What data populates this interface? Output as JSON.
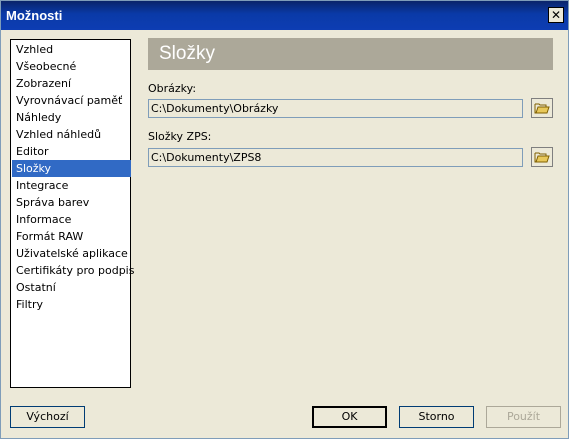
{
  "window": {
    "title": "Možnosti"
  },
  "nav": {
    "items": [
      {
        "label": "Vzhled"
      },
      {
        "label": "Všeobecné"
      },
      {
        "label": "Zobrazení"
      },
      {
        "label": "Vyrovnávací paměť"
      },
      {
        "label": "Náhledy"
      },
      {
        "label": "Vzhled náhledů"
      },
      {
        "label": "Editor"
      },
      {
        "label": "Složky",
        "selected": true
      },
      {
        "label": "Integrace"
      },
      {
        "label": "Správa barev"
      },
      {
        "label": "Informace"
      },
      {
        "label": "Formát RAW"
      },
      {
        "label": "Uživatelské aplikace"
      },
      {
        "label": "Certifikáty pro podpis"
      },
      {
        "label": "Ostatní"
      },
      {
        "label": "Filtry"
      }
    ]
  },
  "panel": {
    "title": "Složky",
    "images_label": "Obrázky:",
    "images_path": "C:\\Dokumenty\\Obrázky",
    "zps_label": "Složky ZPS:",
    "zps_path": "C:\\Dokumenty\\ZPS8"
  },
  "buttons": {
    "default_label": "Výchozí",
    "ok_label": "OK",
    "cancel_label": "Storno",
    "apply_label": "Použít"
  },
  "colors": {
    "selection": "#316ac5",
    "title_gradient": "#0a246a",
    "section_header": "#aca899"
  },
  "icons": {
    "close": "close-icon",
    "browse": "open-folder-icon"
  }
}
